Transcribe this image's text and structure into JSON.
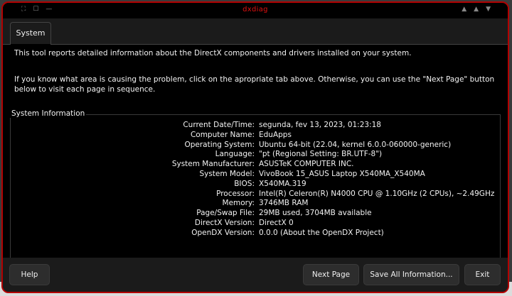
{
  "window": {
    "title": "dxdiag",
    "left_controls": [
      "⛶",
      "☐",
      "—"
    ],
    "right_controls": [
      "▲",
      "▲",
      "▼"
    ]
  },
  "tabs": [
    {
      "label": "System"
    }
  ],
  "description": {
    "line1": "This tool reports detailed information about the DirectX components and drivers installed on your system.",
    "line2": "If you know what area is causing the problem, click on the apropriate tab above. Otherwise, you can use the \"Next Page\" button below to visit each page in sequence."
  },
  "system_info": {
    "label": "System Information",
    "rows": [
      {
        "key": "Current Date/Time:",
        "value": "segunda, fev 13, 2023, 01:23:18"
      },
      {
        "key": "Computer Name:",
        "value": "EduApps"
      },
      {
        "key": "Operating System:",
        "value": "Ubuntu 64-bit (22.04, kernel 6.0.0-060000-generic)"
      },
      {
        "key": "Language:",
        "value": "\"pt (Regional Setting: BR.UTF-8\")"
      },
      {
        "key": "System Manufacturer:",
        "value": "ASUSTeK COMPUTER INC."
      },
      {
        "key": "System Model:",
        "value": "VivoBook 15_ASUS Laptop X540MA_X540MA"
      },
      {
        "key": "BIOS:",
        "value": "X540MA.319"
      },
      {
        "key": "Processor:",
        "value": "Intel(R) Celeron(R) N4000 CPU @ 1.10GHz (2 CPUs), ~2.49GHz"
      },
      {
        "key": "Memory:",
        "value": "3746MB RAM"
      },
      {
        "key": "Page/Swap File:",
        "value": "29MB used, 3704MB available"
      },
      {
        "key": "DirectX Version:",
        "value": "DirectX 0"
      },
      {
        "key": "OpenDX Version:",
        "value": "0.0.0 (About the OpenDX Project)"
      }
    ]
  },
  "buttons": {
    "help": "Help",
    "next_page": "Next Page",
    "save_all": "Save All Information...",
    "exit": "Exit"
  },
  "colors": {
    "accent": "#b30000",
    "title": "#e01010",
    "content_bg": "#000000",
    "chrome_bg": "#1b1b1b"
  }
}
